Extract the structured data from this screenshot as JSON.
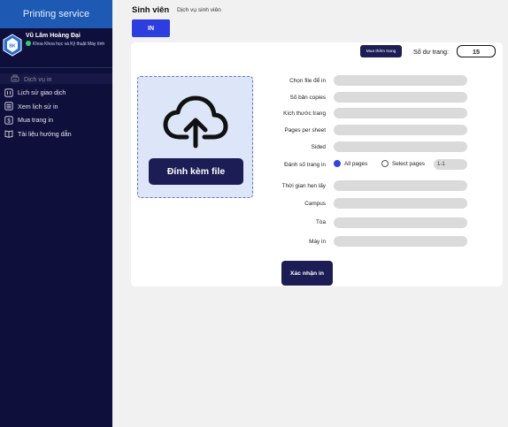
{
  "sidebar": {
    "brand": "Printing service",
    "user": {
      "name": "Vũ Lâm Hoàng Đại",
      "department": "Khoa Khoa học và Kỹ thuật Máy tính",
      "status_color": "#2ecc71"
    },
    "items": [
      {
        "label": "Dịch vụ in",
        "icon": "printer-icon",
        "active": true
      },
      {
        "label": "Lịch sử giao dịch",
        "icon": "transaction-history-icon"
      },
      {
        "label": "Xem lịch sử in",
        "icon": "print-history-icon"
      },
      {
        "label": "Mua trang in",
        "icon": "buy-pages-icon"
      },
      {
        "label": "Tài liệu hướng dẫn",
        "icon": "guide-book-icon"
      }
    ]
  },
  "header": {
    "title": "Sinh viên",
    "subtitle": "Dịch vụ sinh viên",
    "tab_label": "IN"
  },
  "balance": {
    "buy_label": "Mua thêm trang",
    "label": "Số dư trang:",
    "value": "15"
  },
  "upload": {
    "icon": "cloud-upload-icon",
    "button_label": "Đính kèm file"
  },
  "form": {
    "fields": [
      {
        "label": "Chọn file để in",
        "value": ""
      },
      {
        "label": "Số bản copies",
        "value": ""
      },
      {
        "label": "Kích thước trang",
        "value": ""
      },
      {
        "label": "Pages per sheet",
        "value": ""
      },
      {
        "label": "Sided",
        "value": ""
      }
    ],
    "page_numbering": {
      "label": "Đánh số trang in",
      "all_pages": "All pages",
      "select_pages": "Select pages",
      "range_placeholder": "1-1",
      "selected": "all"
    },
    "fields2": [
      {
        "label": "Thời gian hẹn lấy",
        "value": ""
      },
      {
        "label": "Campus",
        "value": ""
      },
      {
        "label": "Tòa",
        "value": ""
      },
      {
        "label": "Máy in",
        "value": ""
      }
    ],
    "confirm_label": "Xác nhận in"
  },
  "colors": {
    "sidebar_bg": "#0f0f3c",
    "brand_bg": "#1e5ab4",
    "primary_button": "#2d3ee0",
    "dark_button": "#1c1d55"
  }
}
